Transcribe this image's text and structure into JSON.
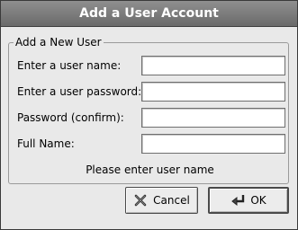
{
  "window": {
    "title": "Add a User Account"
  },
  "group": {
    "legend": "Add a New User"
  },
  "fields": [
    {
      "label": "Enter a user name:",
      "value": ""
    },
    {
      "label": "Enter a user password:",
      "value": ""
    },
    {
      "label": "Password (confirm):",
      "value": ""
    },
    {
      "label": "Full Name:",
      "value": ""
    }
  ],
  "status": "Please enter user name",
  "buttons": {
    "cancel": {
      "label": "Cancel",
      "icon": "close-x-icon"
    },
    "ok": {
      "label": "OK",
      "icon": "check-arrow-icon"
    }
  }
}
